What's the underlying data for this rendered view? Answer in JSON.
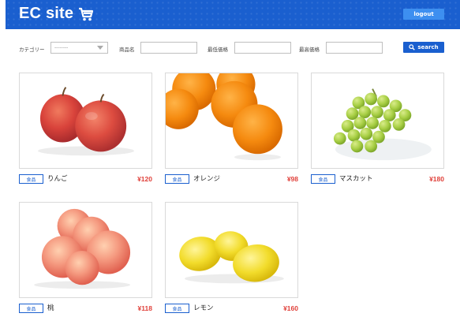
{
  "header": {
    "brand": "EC site",
    "logout_label": "logout",
    "brand_color": "#1a5fcf"
  },
  "filters": {
    "category_label": "カテゴリー",
    "category_selected": "--------",
    "name_label": "商品名",
    "name_value": "",
    "min_price_label": "最低価格",
    "min_price_value": "",
    "max_price_label": "最高価格",
    "max_price_value": "",
    "search_label": "search"
  },
  "products": [
    {
      "name": "りんご",
      "category": "食品",
      "price": "¥120",
      "image": "apples"
    },
    {
      "name": "オレンジ",
      "category": "食品",
      "price": "¥98",
      "image": "oranges"
    },
    {
      "name": "マスカット",
      "category": "食品",
      "price": "¥180",
      "image": "grapes"
    },
    {
      "name": "桃",
      "category": "食品",
      "price": "¥118",
      "image": "peaches"
    },
    {
      "name": "レモン",
      "category": "食品",
      "price": "¥160",
      "image": "lemons"
    }
  ],
  "colors": {
    "price": "#e0403a",
    "accent": "#1a5fcf",
    "logout_button": "#3d8ff0"
  }
}
